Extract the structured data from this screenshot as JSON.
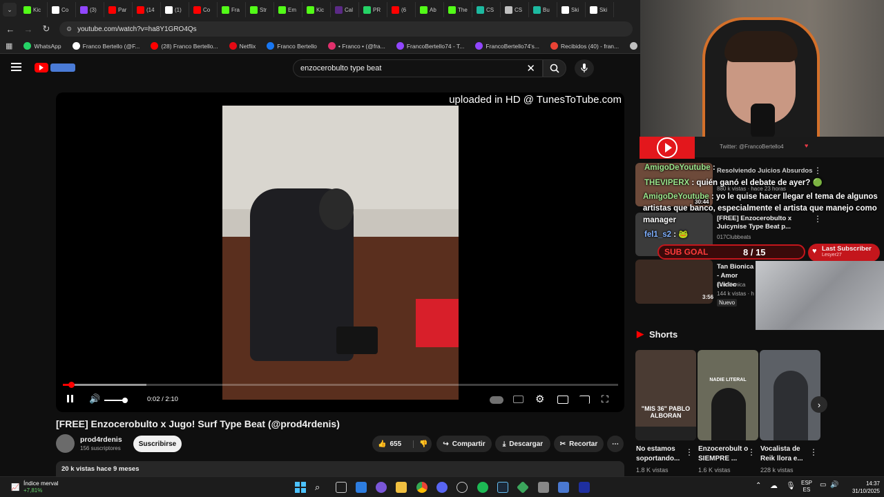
{
  "browser": {
    "tabs": [
      {
        "label": "Kic",
        "color": "#53fc18"
      },
      {
        "label": "Co",
        "color": "#ffffff"
      },
      {
        "label": "(3)",
        "color": "#9146ff"
      },
      {
        "label": "Par",
        "color": "#ff0000"
      },
      {
        "label": "(14",
        "color": "#ff0000"
      },
      {
        "label": "(1)",
        "color": "#ffffff"
      },
      {
        "label": "Co",
        "color": "#ff0000"
      },
      {
        "label": "Fra",
        "color": "#53fc18"
      },
      {
        "label": "Str",
        "color": "#53fc18"
      },
      {
        "label": "Em",
        "color": "#53fc18"
      },
      {
        "label": "Kic",
        "color": "#53fc18"
      },
      {
        "label": "Cal",
        "color": "#5b2a86"
      },
      {
        "label": "PR",
        "color": "#25d366"
      },
      {
        "label": "(6",
        "color": "#ff0000"
      },
      {
        "label": "Ab",
        "color": "#53fc18"
      },
      {
        "label": "The",
        "color": "#53fc18"
      },
      {
        "label": "CS",
        "color": "#1db9a0"
      },
      {
        "label": "CS",
        "color": "#c0c0c0"
      },
      {
        "label": "Bu",
        "color": "#1db9a0"
      },
      {
        "label": "Ski",
        "color": "#ffffff"
      },
      {
        "label": "Ski",
        "color": "#ffffff"
      }
    ],
    "url": "youtube.com/watch?v=ha8Y1GRO4Qs",
    "bookmarks": [
      {
        "label": "WhatsApp",
        "color": "#25d366"
      },
      {
        "label": "Franco Bertello (@F...",
        "color": "#ffffff"
      },
      {
        "label": "(28) Franco Bertello...",
        "color": "#ff0000"
      },
      {
        "label": "Netflix",
        "color": "#e50914"
      },
      {
        "label": "Franco Bertello",
        "color": "#1877f2"
      },
      {
        "label": "• Franco • (@fra...",
        "color": "#e1306c"
      },
      {
        "label": "FrancoBertello74 - T...",
        "color": "#9146ff"
      },
      {
        "label": "FrancoBertello74's...",
        "color": "#9146ff"
      },
      {
        "label": "Recibidos (40) - fran...",
        "color": "#ea4335"
      },
      {
        "label": "outlook",
        "color": "#c0c0c0"
      },
      {
        "label": "Aler",
        "color": "#53fc18"
      }
    ]
  },
  "youtube": {
    "search_query": "enzocerobulto type beat",
    "player": {
      "watermark": "uploaded in HD @ TunesToTube.com",
      "time": "0:02 / 2:10",
      "progress": 0.015,
      "volume": 1.0
    },
    "video_title": "[FREE] Enzocerobulto x Jugo! Surf Type Beat (@prod4rdenis)",
    "channel": {
      "name": "prod4rdenis",
      "subscribers": "156 suscriptores",
      "subscribe_label": "Suscribirse"
    },
    "actions": {
      "likes": "655",
      "share": "Compartir",
      "download": "Descargar",
      "clip": "Recortar"
    },
    "description_meta": "20 k vistas  hace 9 meses"
  },
  "overlay": {
    "twitter_handle": "Twitter: @FrancoBertello4",
    "chat": [
      {
        "user": "AmigoDeYoutube",
        "text": ""
      },
      {
        "user": "THEVIPERX",
        "text": "quién ganó el debate de ayer? 🟢"
      },
      {
        "user": "AmigoDeYoutube",
        "text": "yo le quise hacer llegar el tema de algunos artistas que banco, especialmente el artista que manejo como manager"
      },
      {
        "user": "fel1_s2",
        "text": "🐸"
      }
    ],
    "sub_goal_label": "SUB GOAL",
    "sub_goal_value": "8 / 15",
    "last_subscriber_label": "Last Subscriber",
    "last_subscriber_name": "Lesyer27"
  },
  "recommendations": [
    {
      "title": "Resolviendo Juicios Absurdos",
      "meta": "880 k vistas · hace 23 horas",
      "duration": "30:44"
    },
    {
      "title": "[FREE] Enzocerobulto x Juicynise Type Beat p...",
      "meta": "017Clubbeats",
      "duration": ""
    },
    {
      "title": "Tan Bionica - Amor (Video",
      "channel": "Tan Bionica",
      "meta": "144 k vistas · h",
      "badge": "Nuevo",
      "duration": "3:56"
    }
  ],
  "shorts": {
    "heading": "Shorts",
    "items": [
      {
        "title": "No estamos soportando...",
        "views": "1.8 K vistas",
        "caption": "\"MIS 36\" PABLO ALBORAN"
      },
      {
        "title": "Enzocerobult o SIEMPRE ...",
        "views": "1.6 K vistas",
        "caption": "NADIE LITERAL"
      },
      {
        "title": "Vocalista de Reik llora e...",
        "views": "228 k vistas",
        "caption": ""
      }
    ]
  },
  "taskbar": {
    "widget_title": "Índice merval",
    "widget_value": "+7,81%",
    "language": "ESP",
    "region": "ES",
    "time": "14:37",
    "date": "31/10/2025"
  }
}
